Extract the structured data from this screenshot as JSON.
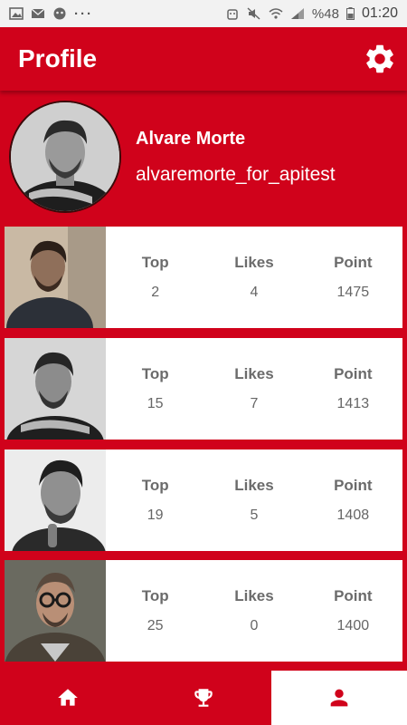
{
  "status_bar": {
    "battery": "%48",
    "time": "01:20",
    "more": "···"
  },
  "app_bar": {
    "title": "Profile",
    "settings_icon": "gear-icon"
  },
  "profile": {
    "name": "Alvare Morte",
    "username": "alvaremorte_for_apitest"
  },
  "colors": {
    "primary": "#d0021b",
    "card": "#ffffff",
    "label": "#6b6b6b"
  },
  "cards": [
    {
      "stats": [
        {
          "label": "Top",
          "value": "2"
        },
        {
          "label": "Likes",
          "value": "4"
        },
        {
          "label": "Point",
          "value": "1475"
        }
      ]
    },
    {
      "stats": [
        {
          "label": "Top",
          "value": "15"
        },
        {
          "label": "Likes",
          "value": "7"
        },
        {
          "label": "Point",
          "value": "1413"
        }
      ]
    },
    {
      "stats": [
        {
          "label": "Top",
          "value": "19"
        },
        {
          "label": "Likes",
          "value": "5"
        },
        {
          "label": "Point",
          "value": "1408"
        }
      ]
    },
    {
      "stats": [
        {
          "label": "Top",
          "value": "25"
        },
        {
          "label": "Likes",
          "value": "0"
        },
        {
          "label": "Point",
          "value": "1400"
        }
      ]
    }
  ],
  "bottom_nav": {
    "items": [
      {
        "icon": "home-icon"
      },
      {
        "icon": "trophy-icon"
      },
      {
        "icon": "person-icon",
        "active": true
      }
    ]
  }
}
